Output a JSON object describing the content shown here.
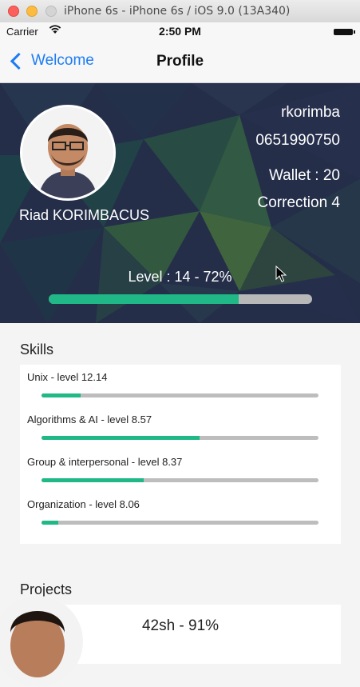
{
  "window": {
    "title": "iPhone 6s - iPhone 6s / iOS 9.0 (13A340)"
  },
  "status_bar": {
    "carrier": "Carrier",
    "wifi_icon": "wifi-icon",
    "time": "2:50 PM",
    "battery_icon": "battery-icon"
  },
  "nav": {
    "back_label": "Welcome",
    "title": "Profile"
  },
  "profile": {
    "full_name": "Riad KORIMBACUS",
    "login": "rkorimba",
    "phone": "0651990750",
    "wallet": "Wallet : 20",
    "correction": "Correction 4",
    "level_text": "Level : 14 - 72%",
    "level_progress": 0.72
  },
  "skills": {
    "title": "Skills",
    "items": [
      {
        "label": "Unix - level 12.14",
        "progress": 0.14
      },
      {
        "label": "Algorithms & AI - level 8.57",
        "progress": 0.57
      },
      {
        "label": "Group & interpersonal - level 8.37",
        "progress": 0.37
      },
      {
        "label": "Organization - level 8.06",
        "progress": 0.06
      }
    ]
  },
  "projects": {
    "title": "Projects",
    "items": [
      {
        "label": "42sh - 91%"
      }
    ]
  },
  "colors": {
    "accent": "#1c7cf4",
    "progress": "#1fb886",
    "track": "#bdbdbd",
    "banner": "#26304a"
  }
}
